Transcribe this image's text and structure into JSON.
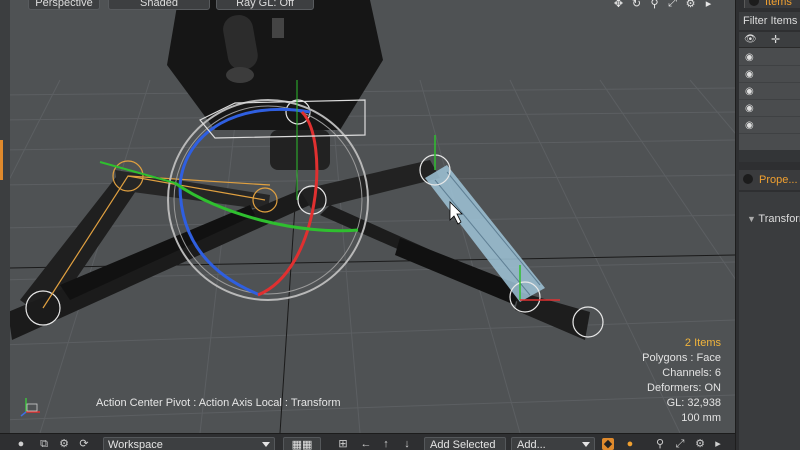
{
  "viewport_bar": {
    "projection": "Perspective",
    "shading": "Shaded",
    "ray_gl": "Ray GL: Off",
    "icons": [
      "move-view-icon",
      "rotate-view-icon",
      "zoom-view-icon",
      "fit-view-icon",
      "settings-icon",
      "expand-icon"
    ]
  },
  "viewport_info": {
    "items": "2 Items",
    "polygons": "Polygons : Face",
    "channels": "Channels: 6",
    "deformers": "Deformers: ON",
    "gl": "GL: 32,938",
    "scale": "100 mm"
  },
  "action_center": "Action Center Pivot : Action Axis Local : Transform",
  "right_panel": {
    "items_tab": "Items",
    "filter": "Filter Items",
    "properties_tab": "Prope...",
    "transform": "Transform"
  },
  "bottom_toolbar": {
    "workspace": "Workspace",
    "add_selected": "Add Selected",
    "add": "Add..."
  },
  "colors": {
    "viewport_bg": "#4f5254",
    "accent": "#f0a030",
    "selection": "#9fc4d8"
  }
}
